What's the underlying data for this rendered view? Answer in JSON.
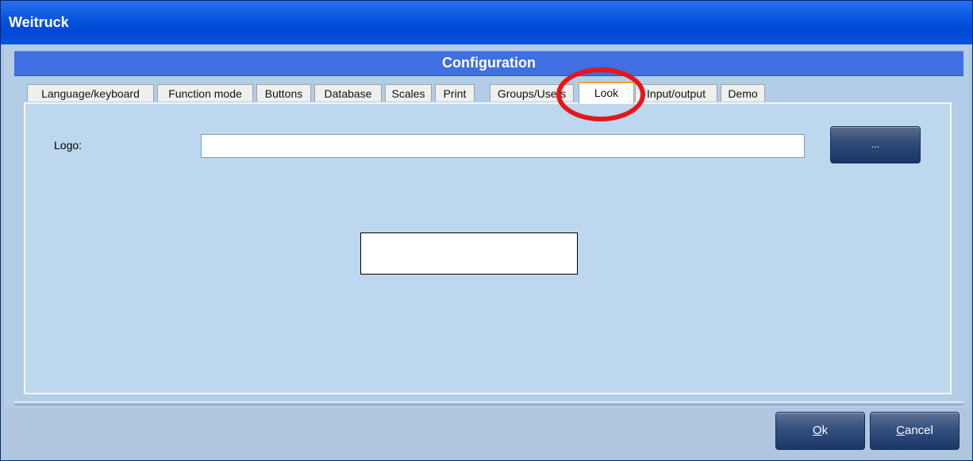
{
  "window": {
    "title": "Weitruck"
  },
  "header": {
    "title": "Configuration"
  },
  "tabs": [
    {
      "label": "Language/keyboard",
      "active": false
    },
    {
      "label": "Function mode",
      "active": false
    },
    {
      "label": "Buttons",
      "active": false
    },
    {
      "label": "Database",
      "active": false
    },
    {
      "label": "Scales",
      "active": false
    },
    {
      "label": "Print",
      "active": false
    },
    {
      "label": "Groups/Users",
      "active": false
    },
    {
      "label": "Look",
      "active": true
    },
    {
      "label": "Input/output",
      "active": false
    },
    {
      "label": "Demo",
      "active": false
    }
  ],
  "look": {
    "logo_label": "Logo:",
    "logo_value": "",
    "browse_label": "..."
  },
  "footer": {
    "ok_label_mnemonic": "O",
    "ok_label_rest": "k",
    "cancel_label_mnemonic": "C",
    "cancel_label_rest": "ancel"
  },
  "annotation": {
    "color": "#e8141a"
  }
}
